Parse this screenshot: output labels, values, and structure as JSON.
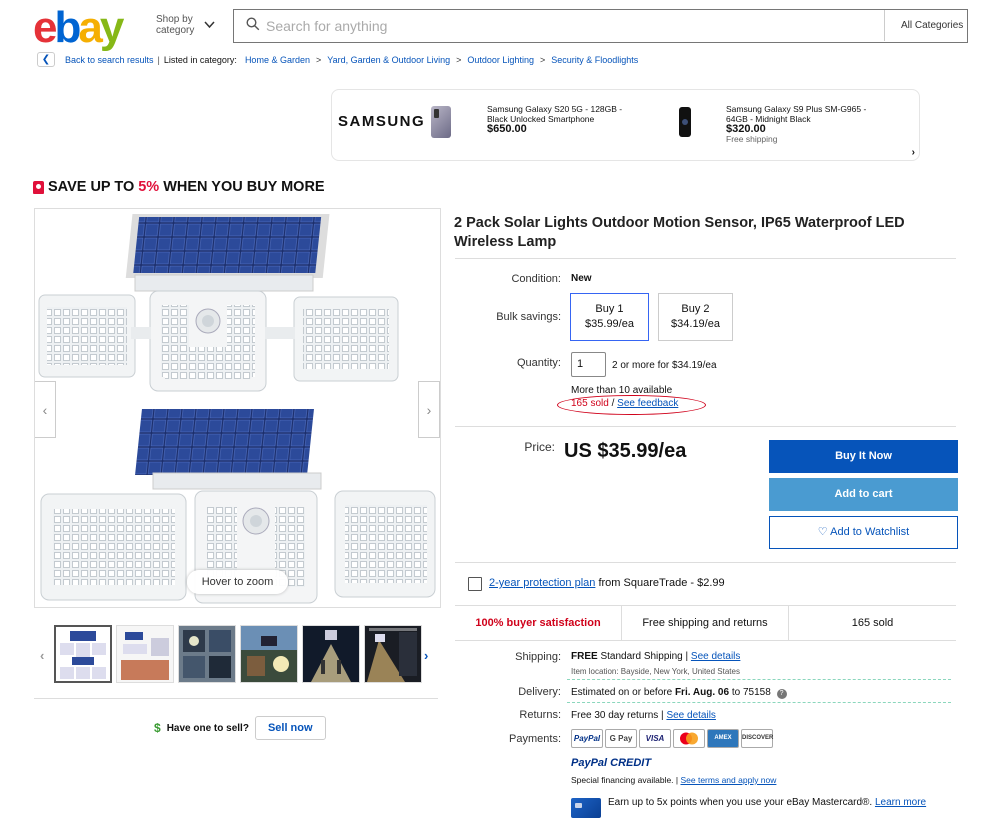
{
  "header": {
    "logo": [
      "e",
      "b",
      "a",
      "y"
    ],
    "shop_by": "Shop by",
    "shop_by2": "category",
    "search_placeholder": "Search for anything",
    "category_label": "All Categories"
  },
  "breadcrumb": {
    "back": "Back to search results",
    "listed": "Listed in category:",
    "items": [
      "Home & Garden",
      "Yard, Garden & Outdoor Living",
      "Outdoor Lighting",
      "Security & Floodlights"
    ]
  },
  "ad": {
    "brand": "SAMSUNG",
    "item1": {
      "line1": "Samsung Galaxy S20 5G - 128GB -",
      "line2": "Black Unlocked Smartphone",
      "price": "$650.00"
    },
    "item2": {
      "line1": "Samsung Galaxy S9 Plus SM-G965 -",
      "line2": "64GB - Midnight Black",
      "price": "$320.00",
      "ship": "Free shipping"
    }
  },
  "promo": {
    "pre": "SAVE UP TO ",
    "pct": "5%",
    "post": " WHEN YOU BUY MORE"
  },
  "gallery": {
    "hover": "Hover to zoom"
  },
  "sell": {
    "question": "Have one to sell?",
    "button": "Sell now"
  },
  "product": {
    "title": "2 Pack Solar Lights Outdoor Motion Sensor, IP65 Waterproof LED Wireless Lamp",
    "condition_label": "Condition:",
    "condition": "New",
    "bulk_label": "Bulk savings:",
    "bulk": [
      {
        "l1": "Buy 1",
        "l2": "$35.99/ea"
      },
      {
        "l1": "Buy 2",
        "l2": "$34.19/ea"
      }
    ],
    "quantity_label": "Quantity:",
    "quantity": "1",
    "quantity_note": "2 or more for $34.19/ea",
    "available": "More than 10 available",
    "sold": "165 sold",
    "slash": " / ",
    "feedback": "See feedback",
    "price_label": "Price:",
    "price": "US $35.99/ea",
    "buy": "Buy It Now",
    "cart": "Add to cart",
    "watch": "Add to Watchlist",
    "protection_link": "2-year protection plan",
    "protection_rest": " from SquareTrade - $2.99"
  },
  "badges": [
    "100% buyer satisfaction",
    "Free shipping and returns",
    "165 sold"
  ],
  "shipping": {
    "label": "Shipping:",
    "free": "FREE",
    "std": "Standard Shipping |",
    "details": "See details",
    "location": "Item location:  Bayside, New York, United States"
  },
  "delivery": {
    "label": "Delivery:",
    "pre": "Estimated on or before ",
    "date": "Fri. Aug. 06",
    "post": " to 75158"
  },
  "returns": {
    "label": "Returns:",
    "text": "Free 30 day returns |",
    "details": "See details"
  },
  "payments": {
    "label": "Payments:",
    "methods": [
      "PayPal",
      "G Pay",
      "VISA",
      "",
      "AMEX",
      "DISCOVER"
    ],
    "paypal_credit": "PayPal CREDIT",
    "financing": "Special financing available. |",
    "terms": "See terms and apply now",
    "mastercard": "Earn up to 5x points when you use your eBay Mastercard®.",
    "learn": "Learn more"
  },
  "colors": {
    "blue": "#0654ba",
    "red": "#d0021b",
    "light_blue": "#4a9bd1"
  }
}
